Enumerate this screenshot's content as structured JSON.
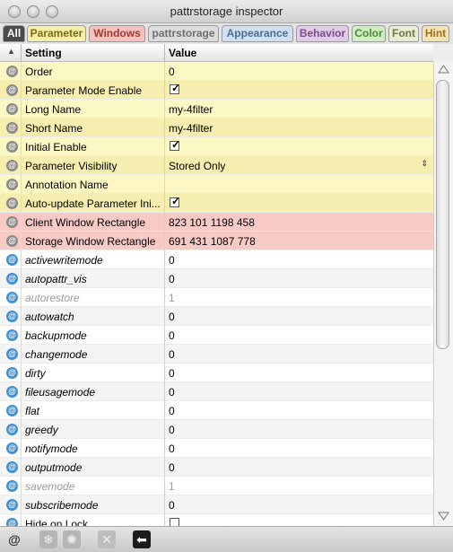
{
  "window": {
    "title": "pattrstorage inspector"
  },
  "tabs": [
    {
      "label": "All",
      "bg": "#4a4a4a",
      "fg": "#ffffff"
    },
    {
      "label": "Parameter",
      "bg": "#f7efa7",
      "fg": "#7a6a15"
    },
    {
      "label": "Windows",
      "bg": "#f7c1bd",
      "fg": "#9b3b33"
    },
    {
      "label": "pattrstorage",
      "bg": "#dcdcdc",
      "fg": "#6e6e6e"
    },
    {
      "label": "Appearance",
      "bg": "#cfe0f2",
      "fg": "#4a6e92"
    },
    {
      "label": "Behavior",
      "bg": "#e1cbe9",
      "fg": "#7a4a8a"
    },
    {
      "label": "Color",
      "bg": "#cfefc1",
      "fg": "#4c8a3b"
    },
    {
      "label": "Font",
      "bg": "#e8ecd3",
      "fg": "#6e7a4a"
    },
    {
      "label": "Hint",
      "bg": "#f5e3b5",
      "fg": "#9a7420"
    }
  ],
  "header": {
    "arrow": "▲",
    "setting": "Setting",
    "value": "Value"
  },
  "row_colors": {
    "parameter": "#fbf8c4",
    "parameter_alt": "#f5eeae",
    "windows": "#f8cac6",
    "plain": "#ffffff",
    "plain_alt": "#f4f4f4"
  },
  "rows": [
    {
      "setting": "Order",
      "value": "0",
      "type": "text",
      "group": "parameter",
      "style": "normal"
    },
    {
      "setting": "Parameter Mode Enable",
      "value": "",
      "type": "check",
      "checked": true,
      "group": "parameter",
      "style": "normal"
    },
    {
      "setting": "Long Name",
      "value": "my-4filter",
      "type": "text",
      "group": "parameter",
      "style": "normal"
    },
    {
      "setting": "Short Name",
      "value": "my-4filter",
      "type": "text",
      "group": "parameter",
      "style": "normal"
    },
    {
      "setting": "Initial Enable",
      "value": "",
      "type": "check",
      "checked": true,
      "group": "parameter",
      "style": "normal"
    },
    {
      "setting": "Parameter Visibility",
      "value": "Stored Only",
      "type": "menu",
      "group": "parameter",
      "style": "normal"
    },
    {
      "setting": "Annotation Name",
      "value": "",
      "type": "text",
      "group": "parameter",
      "style": "normal"
    },
    {
      "setting": "Auto-update Parameter Ini...",
      "value": "",
      "type": "check",
      "checked": true,
      "group": "parameter",
      "style": "normal"
    },
    {
      "setting": "Client Window Rectangle",
      "value": "823 101 1198 458",
      "type": "text",
      "group": "windows",
      "style": "normal"
    },
    {
      "setting": "Storage Window Rectangle",
      "value": "691 431 1087 778",
      "type": "text",
      "group": "windows",
      "style": "normal"
    },
    {
      "setting": "activewritemode",
      "value": "0",
      "type": "text",
      "group": "plain",
      "style": "italic"
    },
    {
      "setting": "autopattr_vis",
      "value": "0",
      "type": "text",
      "group": "plain",
      "style": "italic"
    },
    {
      "setting": "autorestore",
      "value": "1",
      "type": "text",
      "group": "plain",
      "style": "dim"
    },
    {
      "setting": "autowatch",
      "value": "0",
      "type": "text",
      "group": "plain",
      "style": "italic"
    },
    {
      "setting": "backupmode",
      "value": "0",
      "type": "text",
      "group": "plain",
      "style": "italic"
    },
    {
      "setting": "changemode",
      "value": "0",
      "type": "text",
      "group": "plain",
      "style": "italic"
    },
    {
      "setting": "dirty",
      "value": "0",
      "type": "text",
      "group": "plain",
      "style": "italic"
    },
    {
      "setting": "fileusagemode",
      "value": "0",
      "type": "text",
      "group": "plain",
      "style": "italic"
    },
    {
      "setting": "flat",
      "value": "0",
      "type": "text",
      "group": "plain",
      "style": "italic"
    },
    {
      "setting": "greedy",
      "value": "0",
      "type": "text",
      "group": "plain",
      "style": "italic"
    },
    {
      "setting": "notifymode",
      "value": "0",
      "type": "text",
      "group": "plain",
      "style": "italic"
    },
    {
      "setting": "outputmode",
      "value": "0",
      "type": "text",
      "group": "plain",
      "style": "italic"
    },
    {
      "setting": "savemode",
      "value": "1",
      "type": "text",
      "group": "plain",
      "style": "dim"
    },
    {
      "setting": "subscribemode",
      "value": "0",
      "type": "text",
      "group": "plain",
      "style": "italic"
    },
    {
      "setting": "Hide on Lock",
      "value": "",
      "type": "check",
      "checked": false,
      "group": "plain",
      "style": "normal"
    }
  ],
  "row_icon": {
    "symbol": "@",
    "color": "#3f8fd8",
    "dim_color": "#8a8a8a"
  },
  "bottom_toolbar": {
    "attr_label": "@",
    "buttons": [
      {
        "name": "freeze-icon",
        "glyph": "❄"
      },
      {
        "name": "unfreeze-icon",
        "glyph": "✺"
      },
      {
        "name": "clear-icon",
        "glyph": "✕"
      },
      {
        "name": "back-arrow-icon",
        "glyph": "⬅"
      }
    ]
  }
}
